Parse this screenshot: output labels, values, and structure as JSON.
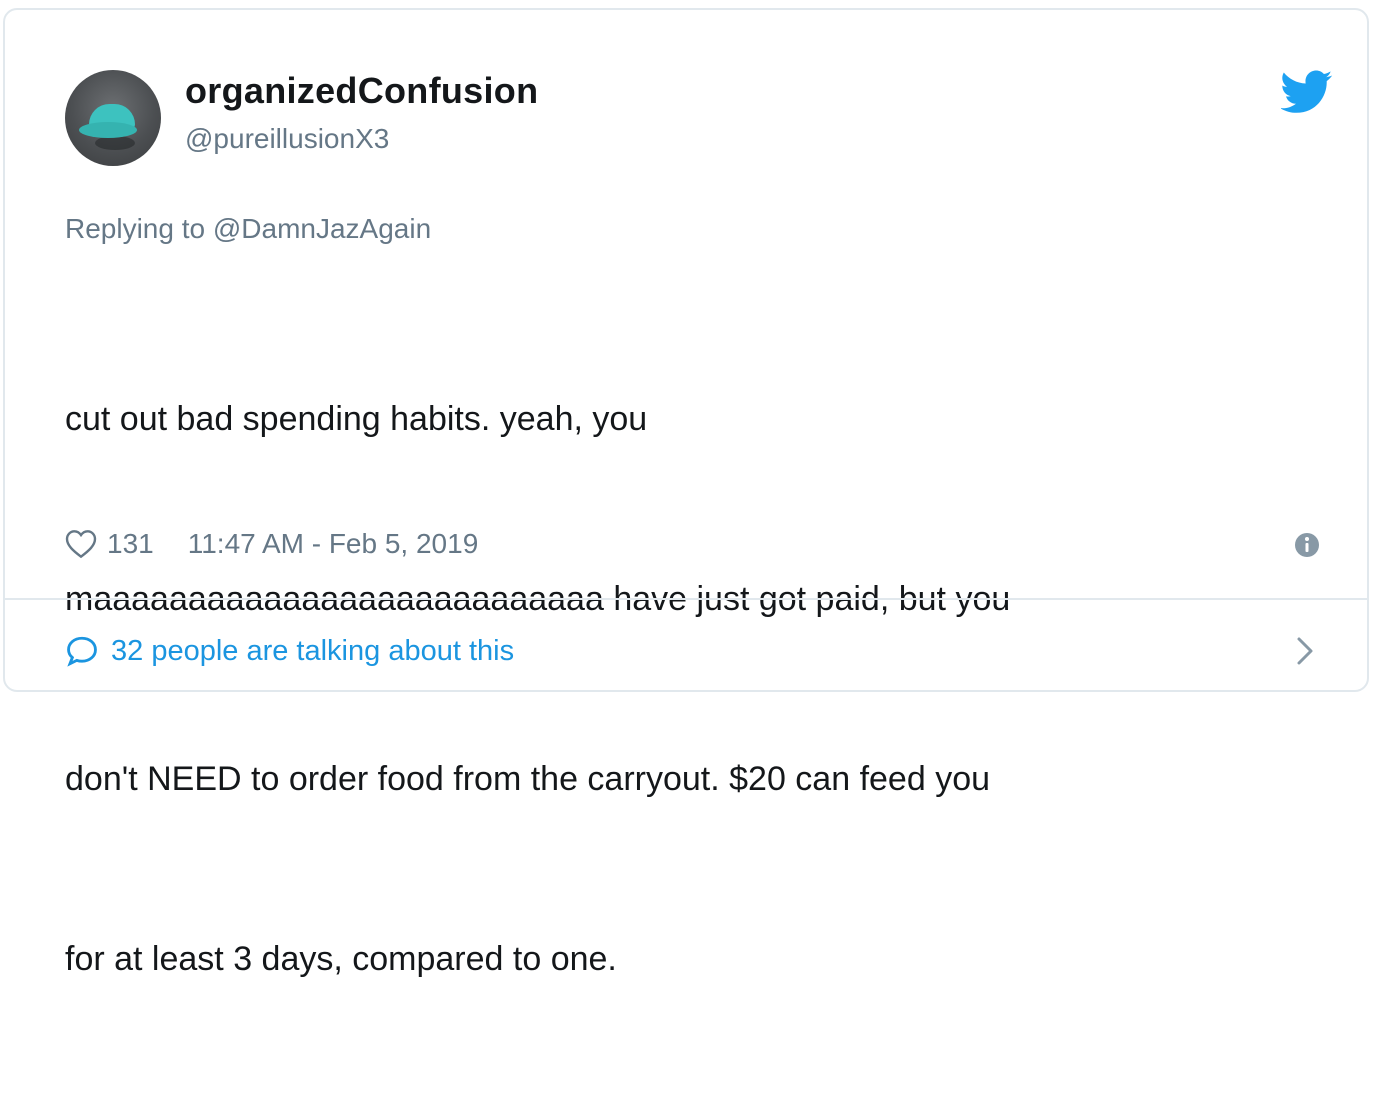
{
  "tweet": {
    "author": {
      "display_name": "organizedConfusion",
      "handle": "@pureillusionX3",
      "avatar_icon": "avatar-photo"
    },
    "reply": {
      "prefix": "Replying to",
      "mention": "@DamnJazAgain"
    },
    "text_lines": [
      "cut out bad spending habits. yeah, you",
      "maaaaaaaaaaaaaaaaaaaaaaaaaaa have just got paid, but you",
      "don't NEED to order food from the carryout. $20 can feed you",
      "for at least 3 days, compared to one."
    ],
    "likes": "131",
    "timestamp": "11:47 AM - Feb 5, 2019",
    "footer_text": "32 people are talking about this"
  },
  "icons": {
    "brand": "twitter-bird-icon",
    "like": "heart-icon",
    "info": "info-icon",
    "comment": "comment-bubble-icon",
    "chevron": "chevron-right-icon"
  },
  "colors": {
    "twitter_blue": "#1da1f2",
    "link_blue": "#1b95e0",
    "secondary_text": "#657786",
    "primary_text": "#14171a",
    "border": "#e1e8ed"
  }
}
